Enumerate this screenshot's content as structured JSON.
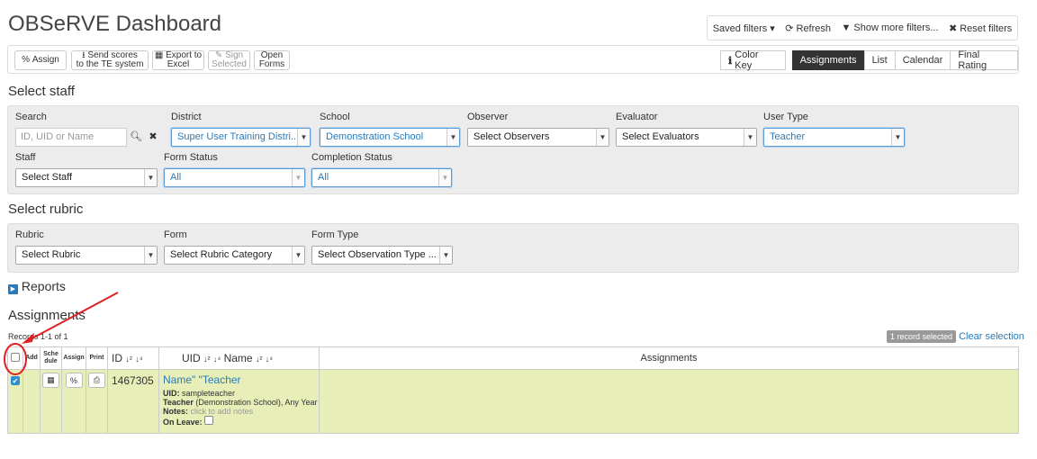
{
  "title": "OBSeRVE Dashboard",
  "topbar": {
    "saved_filters": "Saved filters",
    "refresh": "Refresh",
    "more_filters": "Show more filters...",
    "reset": "Reset filters"
  },
  "toolbar": {
    "assign": "Assign",
    "send_1": "Send scores",
    "send_2": "to the TE system",
    "export_1": "Export to",
    "export_2": "Excel",
    "sign_1": "Sign",
    "sign_2": "Selected",
    "open_1": "Open",
    "open_2": "Forms",
    "color_key": "Color Key",
    "views": [
      "Assignments",
      "List",
      "Calendar",
      "Final Rating"
    ]
  },
  "staff_section": {
    "heading": "Select staff",
    "search_label": "Search",
    "search_placeholder": "ID, UID or Name",
    "district_label": "District",
    "district_value": "Super User Training Distri...",
    "school_label": "School",
    "school_value": "Demonstration School",
    "observer_label": "Observer",
    "observer_value": "Select Observers",
    "evaluator_label": "Evaluator",
    "evaluator_value": "Select Evaluators",
    "usertype_label": "User Type",
    "usertype_value": "Teacher",
    "staff_label": "Staff",
    "staff_value": "Select Staff",
    "formstatus_label": "Form Status",
    "formstatus_value": "All",
    "completion_label": "Completion Status",
    "completion_value": "All"
  },
  "rubric_section": {
    "heading": "Select rubric",
    "rubric_label": "Rubric",
    "rubric_value": "Select Rubric",
    "form_label": "Form",
    "form_value": "Select Rubric Category",
    "formtype_label": "Form Type",
    "formtype_value": "Select Observation Type ..."
  },
  "reports": "Reports",
  "assignments": {
    "heading": "Assignments",
    "records": "Records 1-1 of 1",
    "selected_badge": "1 record selected",
    "clear": "Clear selection",
    "columns": {
      "add": "Add",
      "schedule_1": "Sche",
      "schedule_2": "dule",
      "assign": "Assign",
      "print": "Print",
      "id": "ID",
      "uid_name_1": "UID",
      "uid_name_2": "Name",
      "assignments": "Assignments"
    },
    "row": {
      "id": "1467305",
      "name": "Name\" \"Teacher",
      "uid_label": "UID:",
      "uid": "sampleteacher",
      "role": "Teacher",
      "role_detail": "(Demonstration School), Any Year",
      "notes_label": "Notes:",
      "notes_link": "click to add notes",
      "leave_label": "On Leave:"
    }
  },
  "colors": {
    "active": "#333333",
    "link": "#2a7ab9",
    "row_highlight": "#e8eeb8",
    "annotation": "#e02020"
  }
}
